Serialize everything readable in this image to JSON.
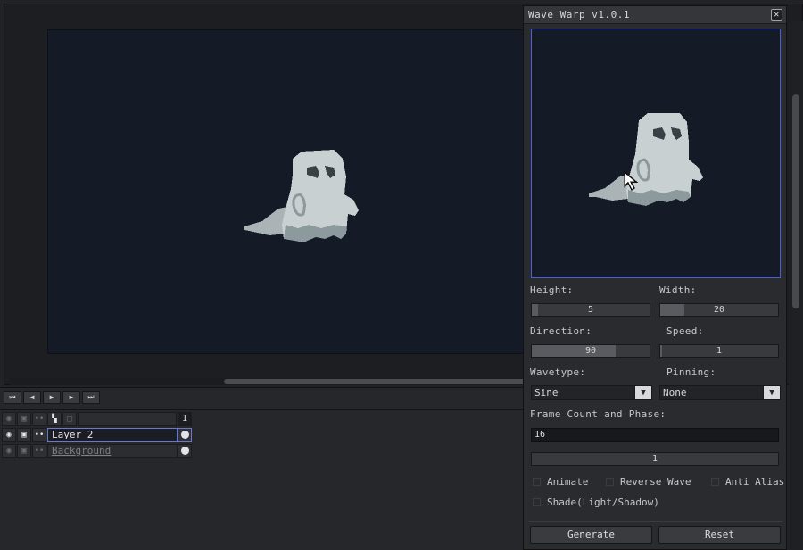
{
  "dialog": {
    "title": "Wave Warp v1.0.1",
    "close_icon": "close-icon",
    "height_label": "Height:",
    "height_value": "5",
    "height_level": 0.05,
    "width_label": "Width:",
    "width_value": "20",
    "width_level": 0.2,
    "direction_label": "Direction:",
    "direction_value": "90",
    "direction_level": 0.7,
    "speed_label": "Speed:",
    "speed_value": "1",
    "speed_level": 0.01,
    "wavetype_label": "Wavetype:",
    "wavetype_value": "Sine",
    "pinning_label": "Pinning:",
    "pinning_value": "None",
    "framecount_label": "Frame Count and Phase:",
    "framecount_value": "16",
    "phase_value": "1",
    "animate_label": "Animate",
    "reverse_label": "Reverse Wave",
    "antialias_label": "Anti Alias",
    "shade_label": "Shade(Light/Shadow)",
    "generate_label": "Generate",
    "reset_label": "Reset"
  },
  "timeline": {
    "controls": [
      "first-frame-icon",
      "prev-frame-icon",
      "play-icon",
      "next-frame-icon",
      "last-frame-icon"
    ],
    "frame_number": "1",
    "layers": [
      {
        "name": "Layer 2",
        "active": true
      },
      {
        "name": "Background",
        "active": false
      }
    ]
  },
  "colors": {
    "canvas_bg": "#141b26",
    "accent": "#4c5fd6",
    "ghost_light": "#c9d0d1",
    "ghost_shadow": "#7e8c90",
    "ghost_eye": "#3a4046"
  }
}
